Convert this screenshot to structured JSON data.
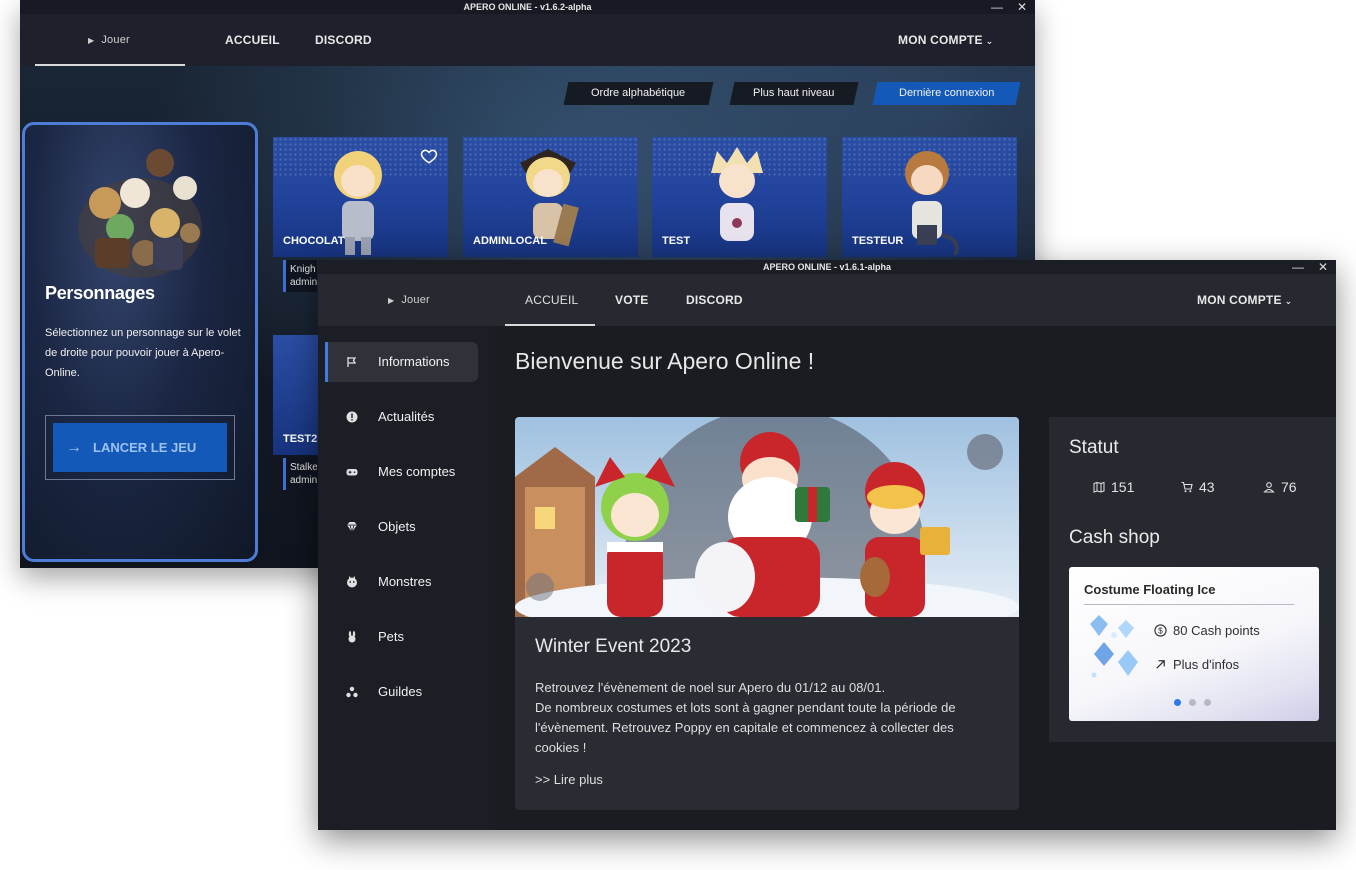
{
  "window_back": {
    "title": "APERO ONLINE - v1.6.2-alpha",
    "window_controls": {
      "minimize": "—",
      "close": "✕"
    },
    "nav": {
      "play": "Jouer",
      "home": "ACCUEIL",
      "discord": "DISCORD",
      "account": "MON COMPTE"
    },
    "sort_buttons": [
      "Ordre alphabétique",
      "Plus haut niveau",
      "Dernière connexion"
    ],
    "active_sort": "Dernière connexion",
    "characters_panel": {
      "title": "Personnages",
      "description": "Sélectionnez un personnage sur le volet de droite pour pouvoir jouer à Apero-Online.",
      "launch_button": "LANCER LE JEU"
    },
    "characters": [
      {
        "name": "CHOCOLAT",
        "favorite": true,
        "info_line1": "Knigh",
        "info_line2": "admin"
      },
      {
        "name": "ADMINLOCAL",
        "favorite": false
      },
      {
        "name": "TEST",
        "favorite": false
      },
      {
        "name": "TESTEUR",
        "favorite": false
      }
    ],
    "characters_row2": [
      {
        "name": "TEST2",
        "info_line1": "Stalke",
        "info_line2": "admin"
      }
    ]
  },
  "window_front": {
    "title": "APERO ONLINE - v1.6.1-alpha",
    "window_controls": {
      "minimize": "—",
      "close": "✕"
    },
    "nav": {
      "play": "Jouer",
      "home": "ACCUEIL",
      "vote": "VOTE",
      "discord": "DISCORD",
      "account": "MON COMPTE"
    },
    "sidebar": [
      {
        "label": "Informations",
        "icon": "flag-icon",
        "active": true
      },
      {
        "label": "Actualités",
        "icon": "alert-icon",
        "active": false
      },
      {
        "label": "Mes comptes",
        "icon": "gamepad-icon",
        "active": false
      },
      {
        "label": "Objets",
        "icon": "gem-icon",
        "active": false
      },
      {
        "label": "Monstres",
        "icon": "monster-icon",
        "active": false
      },
      {
        "label": "Pets",
        "icon": "rabbit-icon",
        "active": false
      },
      {
        "label": "Guildes",
        "icon": "group-icon",
        "active": false
      }
    ],
    "welcome": "Bienvenue sur Apero Online !",
    "news": {
      "title": "Winter Event 2023",
      "body_line1": "Retrouvez l'évènement de noel sur Apero du 01/12 au 08/01.",
      "body_line2": "De nombreux costumes et lots sont à gagner pendant toute la période de l'évènement. Retrouvez Poppy en capitale et commencez à collecter des cookies !",
      "read_more": ">> Lire plus"
    },
    "status": {
      "title": "Statut",
      "maps": "151",
      "vendors": "43",
      "players": "76"
    },
    "cash_shop": {
      "title": "Cash shop",
      "item_name": "Costume Floating Ice",
      "price": "80 Cash points",
      "more": "Plus d'infos",
      "slide_count": 3,
      "active_slide": 1
    }
  },
  "colors": {
    "accent": "#1459b8",
    "accent_light": "#3f7be0",
    "card_blue": "#21429a",
    "window_dark": "#191b21"
  }
}
